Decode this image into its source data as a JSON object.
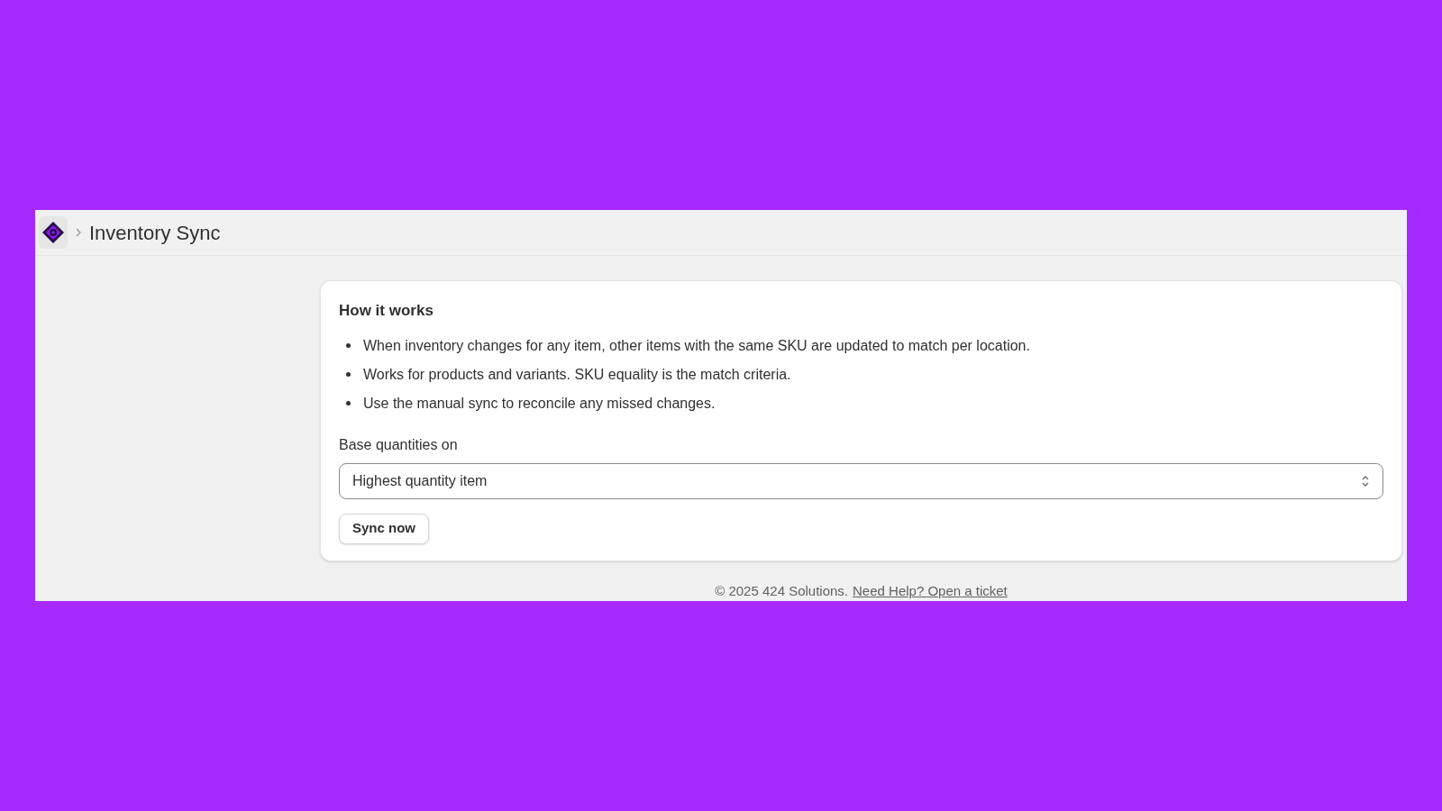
{
  "header": {
    "title": "Inventory Sync"
  },
  "card": {
    "title": "How it works",
    "bullets": [
      "When inventory changes for any item, other items with the same SKU are updated to match per location.",
      "Works for products and variants. SKU equality is the match criteria.",
      "Use the manual sync to reconcile any missed changes."
    ],
    "select": {
      "label": "Base quantities on",
      "value": "Highest quantity item"
    },
    "button": "Sync now"
  },
  "footer": {
    "text": "© 2025 424 Solutions.",
    "link": "Need Help? Open a ticket"
  }
}
